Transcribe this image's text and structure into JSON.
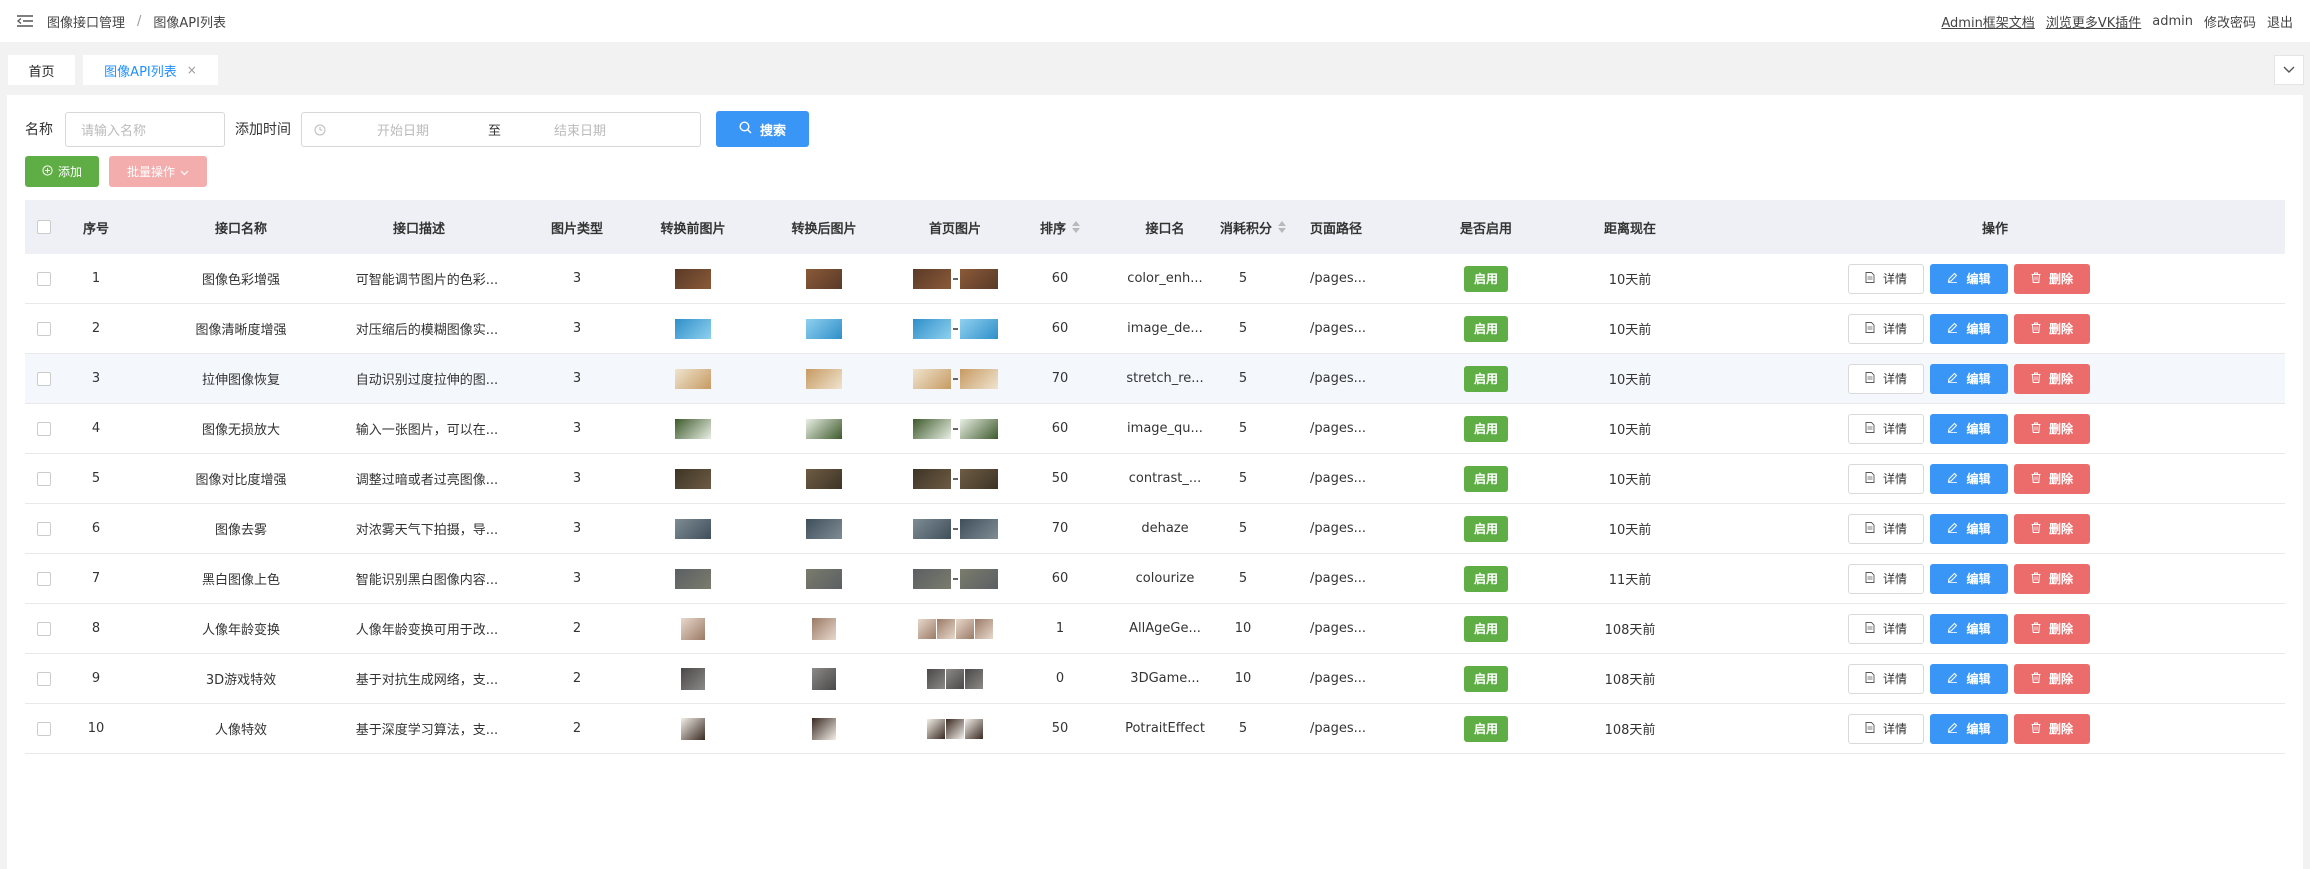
{
  "header": {
    "breadcrumb": [
      "图像接口管理",
      "图像API列表"
    ],
    "links": [
      "Admin框架文档",
      "浏览更多VK插件"
    ],
    "user": "admin",
    "change_password": "修改密码",
    "logout": "退出"
  },
  "tabs": {
    "home": "首页",
    "active": "图像API列表",
    "close_glyph": "×"
  },
  "search": {
    "name_label": "名称",
    "name_placeholder": "请输入名称",
    "time_label": "添加时间",
    "start_placeholder": "开始日期",
    "range_sep": "至",
    "end_placeholder": "结束日期",
    "button": "搜索"
  },
  "actions": {
    "add": "添加",
    "batch": "批量操作"
  },
  "table": {
    "headers": {
      "index": "序号",
      "name": "接口名称",
      "desc": "接口描述",
      "type": "图片类型",
      "before": "转换前图片",
      "after": "转换后图片",
      "cover": "首页图片",
      "sort": "排序",
      "api": "接口名",
      "points": "消耗积分",
      "path": "页面路径",
      "enabled": "是否启用",
      "ago": "距离现在",
      "ops": "操作"
    },
    "rows": [
      {
        "index": "1",
        "name": "图像色彩增强",
        "desc": "可智能调节图片的色彩...",
        "type": "3",
        "sort": "60",
        "api": "color_enh...",
        "points": "5",
        "path": "/pages...",
        "enabled": "启用",
        "ago": "10天前"
      },
      {
        "index": "2",
        "name": "图像清晰度增强",
        "desc": "对压缩后的模糊图像实...",
        "type": "3",
        "sort": "60",
        "api": "image_de...",
        "points": "5",
        "path": "/pages...",
        "enabled": "启用",
        "ago": "10天前"
      },
      {
        "index": "3",
        "name": "拉伸图像恢复",
        "desc": "自动识别过度拉伸的图...",
        "type": "3",
        "sort": "70",
        "api": "stretch_re...",
        "points": "5",
        "path": "/pages...",
        "enabled": "启用",
        "ago": "10天前"
      },
      {
        "index": "4",
        "name": "图像无损放大",
        "desc": "输入一张图片，可以在...",
        "type": "3",
        "sort": "60",
        "api": "image_qu...",
        "points": "5",
        "path": "/pages...",
        "enabled": "启用",
        "ago": "10天前"
      },
      {
        "index": "5",
        "name": "图像对比度增强",
        "desc": "调整过暗或者过亮图像...",
        "type": "3",
        "sort": "50",
        "api": "contrast_...",
        "points": "5",
        "path": "/pages...",
        "enabled": "启用",
        "ago": "10天前"
      },
      {
        "index": "6",
        "name": "图像去雾",
        "desc": "对浓雾天气下拍摄，导...",
        "type": "3",
        "sort": "70",
        "api": "dehaze",
        "points": "5",
        "path": "/pages...",
        "enabled": "启用",
        "ago": "10天前"
      },
      {
        "index": "7",
        "name": "黑白图像上色",
        "desc": "智能识别黑白图像内容...",
        "type": "3",
        "sort": "60",
        "api": "colourize",
        "points": "5",
        "path": "/pages...",
        "enabled": "启用",
        "ago": "11天前"
      },
      {
        "index": "8",
        "name": "人像年龄变换",
        "desc": "人像年龄变换可用于改...",
        "type": "2",
        "sort": "1",
        "api": "AllAgeGe...",
        "points": "10",
        "path": "/pages...",
        "enabled": "启用",
        "ago": "108天前"
      },
      {
        "index": "9",
        "name": "3D游戏特效",
        "desc": "基于对抗生成网络，支...",
        "type": "2",
        "sort": "0",
        "api": "3DGame...",
        "points": "10",
        "path": "/pages...",
        "enabled": "启用",
        "ago": "108天前"
      },
      {
        "index": "10",
        "name": "人像特效",
        "desc": "基于深度学习算法，支...",
        "type": "2",
        "sort": "50",
        "api": "PotraitEffect",
        "points": "5",
        "path": "/pages...",
        "enabled": "启用",
        "ago": "108天前"
      }
    ],
    "op_labels": {
      "detail": "详情",
      "edit": "编辑",
      "delete": "删除"
    }
  },
  "colors": {
    "primary": "#3a96f6",
    "success": "#5fae45",
    "danger": "#ec6b6b",
    "danger_light": "#f3adad",
    "header_bg": "#eef0f5"
  }
}
